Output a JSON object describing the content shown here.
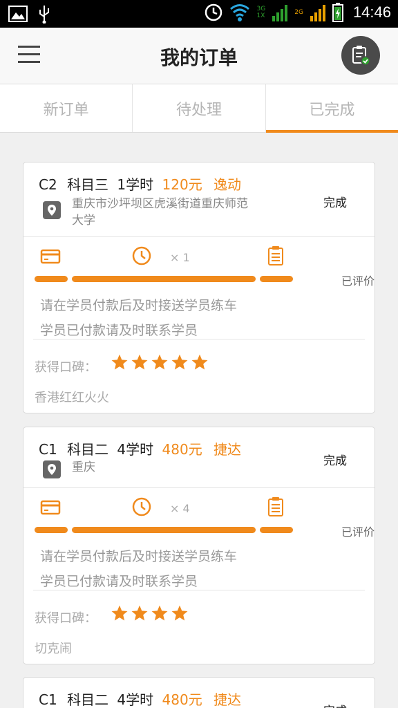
{
  "status_bar": {
    "time": "14:46",
    "net1": "3G",
    "net2": "1X",
    "net3": "2G"
  },
  "header": {
    "title": "我的订单"
  },
  "tabs": [
    {
      "label": "新订单",
      "active": false
    },
    {
      "label": "待处理",
      "active": false
    },
    {
      "label": "已完成",
      "active": true
    }
  ],
  "orders": [
    {
      "license": "C2",
      "subject": "科目三",
      "hours": "1学时",
      "price": "120元",
      "school": "逸动",
      "status": "完成",
      "address_line1": "重庆市沙坪坝区虎溪街道重庆师范",
      "address_line2": "大学",
      "times": "× 1",
      "review_status": "已评价",
      "note1": "请在学员付款后及时接送学员练车",
      "note2": "学员已付款请及时联系学员",
      "reputation_label": "获得口碑：",
      "stars": 5,
      "nickname": "香港红红火火"
    },
    {
      "license": "C1",
      "subject": "科目二",
      "hours": "4学时",
      "price": "480元",
      "school": "捷达",
      "status": "完成",
      "address_line1": "重庆",
      "address_line2": "",
      "times": "× 4",
      "review_status": "已评价",
      "note1": "请在学员付款后及时接送学员练车",
      "note2": "学员已付款请及时联系学员",
      "reputation_label": "获得口碑：",
      "stars": 4,
      "nickname": "切克闹"
    },
    {
      "license": "C1",
      "subject": "科目二",
      "hours": "4学时",
      "price": "480元",
      "school": "捷达",
      "status": "完成"
    }
  ],
  "colors": {
    "accent": "#f08a1c",
    "statusbar": "#000000",
    "star": "#f08a1c"
  }
}
